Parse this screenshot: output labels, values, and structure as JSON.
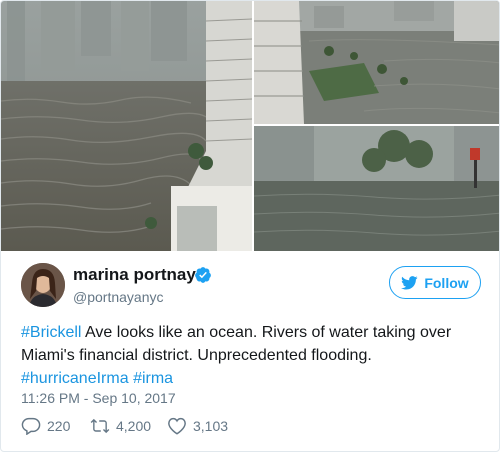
{
  "user": {
    "display_name": "marina portnaya",
    "handle": "@portnayanyc",
    "verified": true
  },
  "follow_button": {
    "label": "Follow"
  },
  "tweet": {
    "segments": [
      {
        "text": "#Brickell",
        "type": "hashtag"
      },
      {
        "text": " Ave looks like an ocean. Rivers of water taking over Miami's financial district. Unprecedented flooding. ",
        "type": "text"
      },
      {
        "text": "#hurricaneIrma",
        "type": "hashtag"
      },
      {
        "text": " ",
        "type": "text"
      },
      {
        "text": "#irma",
        "type": "hashtag"
      }
    ],
    "timestamp": "11:26 PM - Sep 10, 2017"
  },
  "actions": {
    "replies": "220",
    "retweets": "4,200",
    "likes": "3,103"
  },
  "colors": {
    "accent": "#1da1f2",
    "hashtag": "#1b95e0",
    "muted": "#657786",
    "text": "#14171a"
  },
  "icons": {
    "verified": "verified-badge-icon",
    "bird": "twitter-bird-icon",
    "reply": "reply-icon",
    "retweet": "retweet-icon",
    "like": "heart-icon"
  }
}
